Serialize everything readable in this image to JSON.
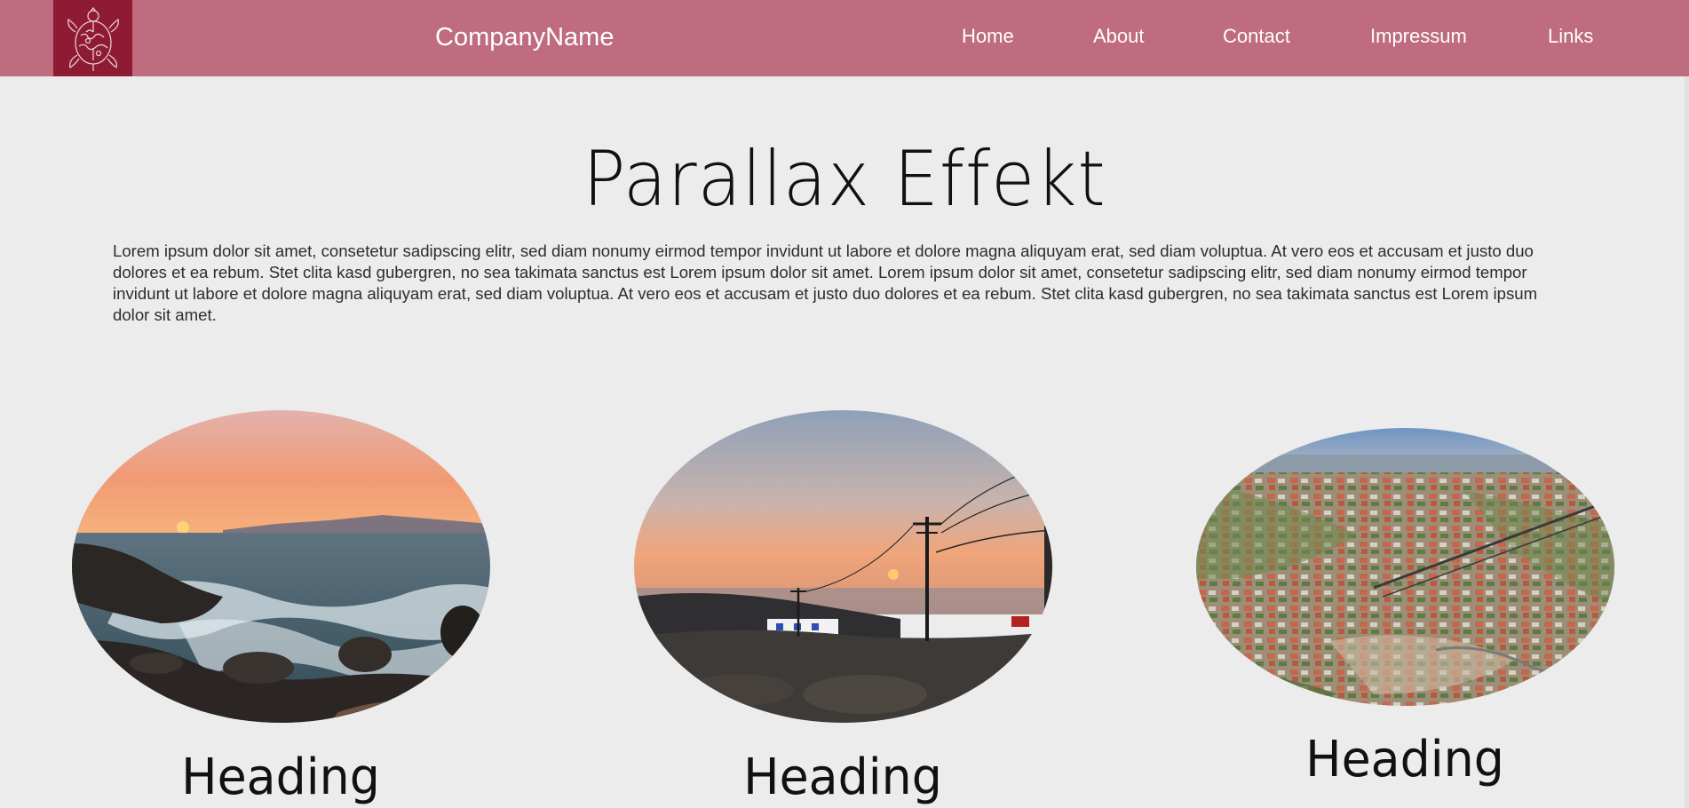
{
  "header": {
    "brand": "CompanyName",
    "logo_icon": "turtle-puzzle-icon",
    "nav": [
      {
        "label": "Home"
      },
      {
        "label": "About"
      },
      {
        "label": "Contact"
      },
      {
        "label": "Impressum"
      },
      {
        "label": "Links"
      }
    ],
    "colors": {
      "bar": "#bf6b80",
      "logo_bg": "#8e1b33"
    }
  },
  "main": {
    "title": "Parallax Effekt",
    "intro": "Lorem ipsum dolor sit amet, consetetur sadipscing elitr, sed diam nonumy eirmod tempor invidunt ut labore et dolore magna aliquyam erat, sed diam voluptua. At vero eos et accusam et justo duo dolores et ea rebum. Stet clita kasd gubergren, no sea takimata sanctus est Lorem ipsum dolor sit amet. Lorem ipsum dolor sit amet, consetetur sadipscing elitr, sed diam nonumy eirmod tempor invidunt ut labore et dolore magna aliquyam erat, sed diam voluptua. At vero eos et accusam et justo duo dolores et ea rebum. Stet clita kasd gubergren, no sea takimata sanctus est Lorem ipsum dolor sit amet.",
    "cards": [
      {
        "image": "sunset-sea-rocks-photo",
        "heading": "Heading"
      },
      {
        "image": "sunset-power-lines-photo",
        "heading": "Heading"
      },
      {
        "image": "aerial-town-photo",
        "heading": "Heading"
      }
    ]
  }
}
